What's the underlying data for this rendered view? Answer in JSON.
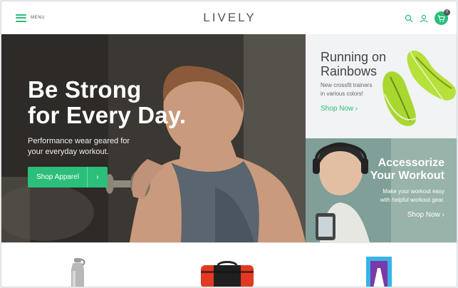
{
  "header": {
    "menu_label": "MENU",
    "brand": "LIVELY",
    "cart_count": "0",
    "icons": [
      "menu-icon",
      "search-icon",
      "user-icon",
      "cart-icon"
    ]
  },
  "hero": {
    "title_line1": "Be Strong",
    "title_line2": "for Every Day.",
    "subtitle_line1": "Performance wear geared for",
    "subtitle_line2": "your everyday workout.",
    "button_label": "Shop Apparel",
    "button_arrow": "›"
  },
  "promo_running": {
    "title_line1": "Running on",
    "title_line2": "Rainbows",
    "subtitle_line1": "New crossfit trainers",
    "subtitle_line2": "in various colors!",
    "link_label": "Shop Now ›"
  },
  "promo_accessorize": {
    "title_line1": "Accessorize",
    "title_line2": "Your Workout",
    "subtitle_line1": "Make your workout easy",
    "subtitle_line2": "with helpful workout gear.",
    "link_label": "Shop Now ›"
  },
  "products": [
    "water-bottle",
    "gym-bag",
    "leggings"
  ],
  "colors": {
    "accent": "#2bbf7a",
    "text_dark": "#444444"
  }
}
